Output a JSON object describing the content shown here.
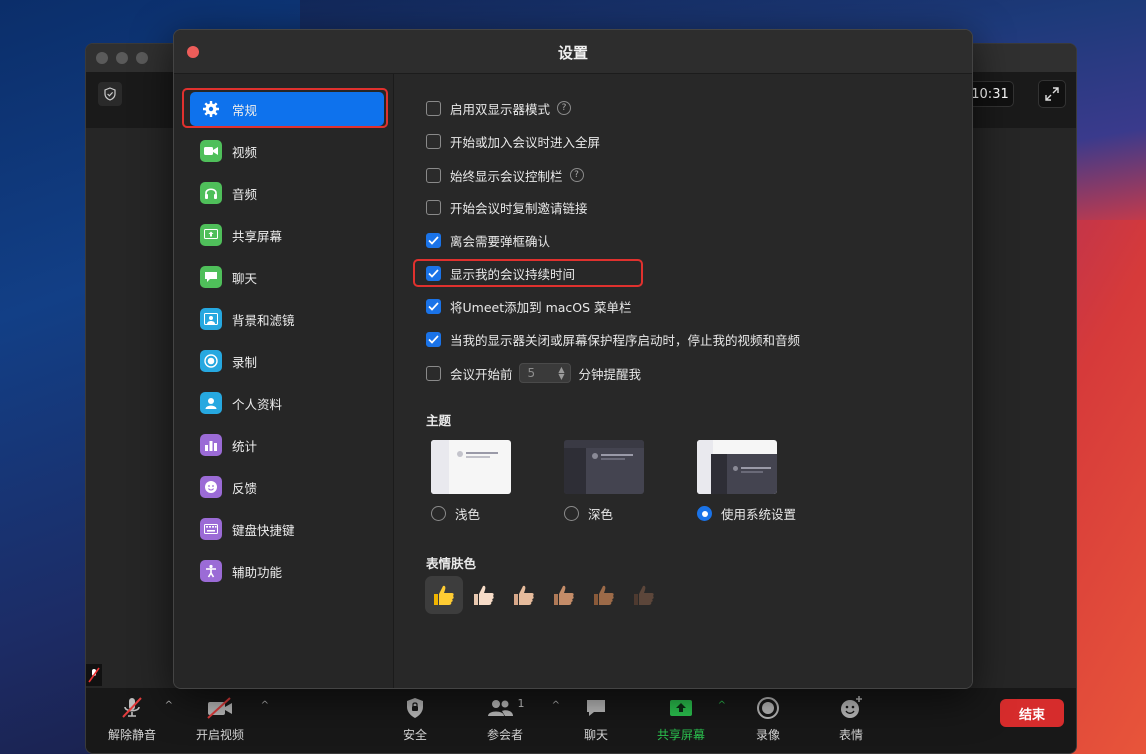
{
  "meeting": {
    "clock": "10:31",
    "toolbar": [
      {
        "label": "解除静音",
        "icon": "mic-muted-icon",
        "caret": true
      },
      {
        "label": "开启视频",
        "icon": "video-off-icon",
        "caret": true
      },
      {
        "label": "安全",
        "icon": "shield-icon",
        "caret": false
      },
      {
        "label": "参会者",
        "icon": "participants-icon",
        "caret": true,
        "count": "1"
      },
      {
        "label": "聊天",
        "icon": "chat-icon",
        "caret": false
      },
      {
        "label": "共享屏幕",
        "icon": "share-screen-icon",
        "caret": true,
        "accent": "#2bc34f"
      },
      {
        "label": "录像",
        "icon": "record-icon",
        "caret": false
      },
      {
        "label": "表情",
        "icon": "emoji-icon",
        "caret": false
      }
    ],
    "end_label": "结束"
  },
  "settings": {
    "title": "设置",
    "nav": [
      {
        "label": "常规",
        "icon": "gear-icon",
        "color": "#0e72ed",
        "active": true
      },
      {
        "label": "视频",
        "icon": "video-icon",
        "color": "#4fbf5a"
      },
      {
        "label": "音频",
        "icon": "headphones-icon",
        "color": "#4fbf5a"
      },
      {
        "label": "共享屏幕",
        "icon": "share-screen-icon",
        "color": "#4fbf5a"
      },
      {
        "label": "聊天",
        "icon": "chat-icon",
        "color": "#4fbf5a"
      },
      {
        "label": "背景和滤镜",
        "icon": "background-icon",
        "color": "#26a8e0"
      },
      {
        "label": "录制",
        "icon": "record-icon",
        "color": "#26a8e0"
      },
      {
        "label": "个人资料",
        "icon": "profile-icon",
        "color": "#26a8e0"
      },
      {
        "label": "统计",
        "icon": "statistics-icon",
        "color": "#9b6bd6"
      },
      {
        "label": "反馈",
        "icon": "feedback-icon",
        "color": "#9b6bd6"
      },
      {
        "label": "键盘快捷键",
        "icon": "keyboard-icon",
        "color": "#9b6bd6"
      },
      {
        "label": "辅助功能",
        "icon": "accessibility-icon",
        "color": "#9b6bd6"
      }
    ],
    "options": [
      {
        "label": "启用双显示器模式",
        "checked": false,
        "help": true
      },
      {
        "label": "开始或加入会议时进入全屏",
        "checked": false
      },
      {
        "label": "始终显示会议控制栏",
        "checked": false,
        "help": true
      },
      {
        "label": "开始会议时复制邀请链接",
        "checked": false
      },
      {
        "label": "离会需要弹框确认",
        "checked": true
      },
      {
        "label": "显示我的会议持续时间",
        "checked": true
      },
      {
        "label": "将Umeet添加到 macOS 菜单栏",
        "checked": true
      },
      {
        "label": "当我的显示器关闭或屏幕保护程序启动时，停止我的视频和音频",
        "checked": true
      }
    ],
    "reminder": {
      "before": "会议开始前",
      "value": "5",
      "after": "分钟提醒我",
      "checked": false
    },
    "theme": {
      "heading": "主题",
      "options": [
        {
          "label": "浅色",
          "selected": false
        },
        {
          "label": "深色",
          "selected": false
        },
        {
          "label": "使用系统设置",
          "selected": true
        }
      ]
    },
    "skin": {
      "heading": "表情肤色",
      "tones": [
        "👍",
        "👍🏻",
        "👍🏼",
        "👍🏽",
        "👍🏾",
        "👍🏿"
      ],
      "selected": 0
    }
  }
}
